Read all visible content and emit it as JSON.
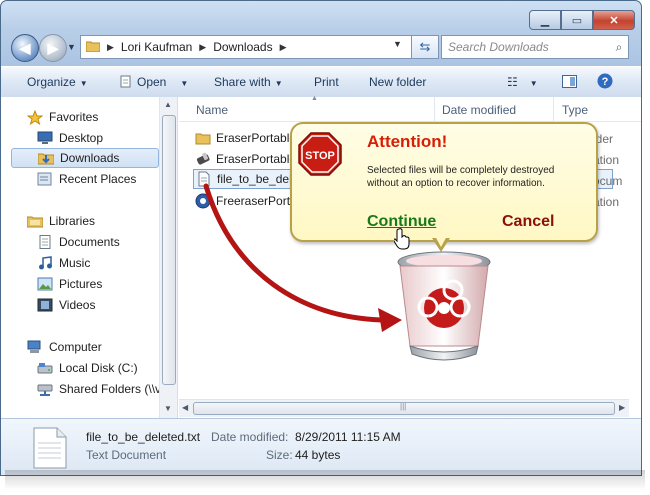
{
  "address": {
    "crumbs": [
      "Lori Kaufman",
      "Downloads"
    ],
    "search_placeholder": "Search Downloads"
  },
  "toolbar": {
    "organize": "Organize",
    "open": "Open",
    "share_with": "Share with",
    "print": "Print",
    "new_folder": "New folder"
  },
  "nav": {
    "favorites": "Favorites",
    "desktop": "Desktop",
    "downloads": "Downloads",
    "recent_places": "Recent Places",
    "libraries": "Libraries",
    "documents": "Documents",
    "music": "Music",
    "pictures": "Pictures",
    "videos": "Videos",
    "computer": "Computer",
    "local_disk": "Local Disk (C:)",
    "shared_folders": "Shared Folders (\\\\v"
  },
  "columns": {
    "name": "Name",
    "date_modified": "Date modified",
    "type": "Type"
  },
  "files": [
    {
      "name": "EraserPortable",
      "type": "lder"
    },
    {
      "name": "EraserPortable",
      "type": "ation"
    },
    {
      "name": "file_to_be_del",
      "type": "ocum"
    },
    {
      "name": "FreeraserPorta",
      "type": "ation"
    }
  ],
  "details": {
    "filename": "file_to_be_deleted.txt",
    "filetype": "Text Document",
    "date_label": "Date modified:",
    "date_value": "8/29/2011 11:15 AM",
    "size_label": "Size:",
    "size_value": "44 bytes"
  },
  "dialog": {
    "stop_label": "STOP",
    "title": "Attention!",
    "message": "Selected files will be completely destroyed without an option to recover information.",
    "continue": "Continue",
    "cancel": "Cancel"
  },
  "colors": {
    "attention": "#d81e05",
    "continue": "#177a16",
    "cancel": "#8b0f0f",
    "arrow": "#b41414"
  }
}
